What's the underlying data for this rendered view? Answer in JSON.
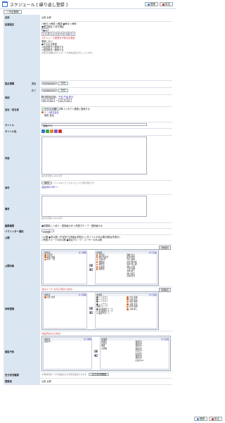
{
  "header": {
    "title": "スケジュール [ 繰り返し登録 ]",
    "add_label": "登録",
    "back_label": "戻る"
  },
  "subbar": {
    "single_label": "一予定登録"
  },
  "labels": {
    "name": "名前",
    "repeat": "拡張設定",
    "period": "設定期間",
    "start": "開始",
    "end": "終了",
    "time": "時刻",
    "org": "会社・担当者",
    "title": "タイトル",
    "color": "タイトル色",
    "content": "内容",
    "attach": "添付",
    "memo": "備考",
    "edit": "編集権限",
    "remind": "リマインダー通知",
    "public": "公開",
    "target": "公開対象",
    "regist": "同時登録",
    "facility": "施設予約",
    "approve": "登録者"
  },
  "values": {
    "name": "山田 太郎",
    "repeat_line1": "○毎日 ○毎週 ○隔週 ●毎月 ○毎年",
    "repeat_line2": "●曜日指定 ○日付指定",
    "week_no": "第１",
    "days": [
      "日",
      "月",
      "火",
      "水",
      "木",
      "金",
      "土"
    ],
    "holiday_note": "スケジュール登録日が休日の場合",
    "holiday_opts": [
      "登録しない",
      "●そのまま登録",
      "○前営業日へ登録する",
      "○翌営業日へ登録する"
    ],
    "holiday_note2": "※休日の判断はタイムカードの基本設定を元にしています。",
    "start_date": "2025/04/01",
    "end_date": "2026/03/31",
    "today": "今日",
    "time_flag": "時間指定無し",
    "time_links": "午前 午後 終日",
    "time_from": "09",
    "time_from_m": "00",
    "time_to": "10",
    "time_to_m": "00",
    "addr_btn": "アドレス帳",
    "contact": "コンタクト履歴に登録する",
    "company": "ミニ1株式会社",
    "person": "相田 進治",
    "title_val": "週報MTG",
    "content_note": "最大文字数 1,000 文字",
    "attach_btn": "添付",
    "attach_hint": "ファイルをドラッグ＆ドロップで添付可能です",
    "attach_file": "会議資料.PDF",
    "memo_note": "最大文字数 1,000 文字",
    "edit_val": "●制限無し ○本人・登録者のみ ○所属グループ・登録者のみ",
    "remind_val": "15分前",
    "public_val": "○公開 ●非公開 ○予定有り(詳細は非表示) ○タイトルのみ公開(詳細は非表示)",
    "public_val2": "○所属グループのみ公開 ●指定グループ・ユーザーのみ公開",
    "selected_label": "選択済",
    "all_delete": "全て削除",
    "unselected_label": "未選択",
    "all_add": "全て追加",
    "detail_btn": "詳細検索",
    "group_note": "[他のユーザーを同じ登録する場合]",
    "facility_note": "[施設予約をする場合]",
    "approve_note": "※同時登録ユーザや施設の空き状況を確認できます。",
    "check_btn": "空き状況確認",
    "approver": "山田 太郎"
  },
  "public_sel": [
    "企画部",
    "彩椿 由香",
    "鈴木 一郎"
  ],
  "public_uns": [
    "企画部",
    "経営企画部",
    "営業1部",
    "総務部",
    "業務部",
    "広報部",
    "開発部"
  ],
  "public_uns2": [
    "岡崎 直之",
    "服部 修也",
    "内山 俊樹",
    "鈴木 明日香",
    "坂本 慎三朗",
    "細谷 英昭",
    "上田 高聡",
    "村中 勇二",
    "野村 輝子",
    "宮城 周司"
  ],
  "reg_sel": [
    "山田 太郎"
  ],
  "reg_uns": [
    "■ レイアウト",
    "■ レイアウト",
    "■ レイアウト",
    "■ レイアウト",
    "業務グループ",
    "■ 第2開発グループ",
    "★ 第3開発グループ",
    "★ 技術サポート"
  ],
  "reg_uns2": [
    "大谷 秀樹",
    "小谷 恭子",
    "田中 優樹",
    "山田 洋高",
    "北田 寛樹",
    "山本 理二"
  ],
  "fac_sel": [
    "会議室1"
  ],
  "fac_uns": [
    "会議室",
    "応接室",
    "備品",
    "応用機"
  ],
  "fac_uns2": [
    "会議室1",
    "会議室2",
    "会議室3",
    "会議室4",
    "応接室1",
    "応接室2",
    "会議室5",
    "会議室6",
    "応接室10"
  ],
  "colors": [
    "#3a6fc4",
    "#3fa34d",
    "#d98a2a",
    "#8a55c0",
    "#c33"
  ]
}
